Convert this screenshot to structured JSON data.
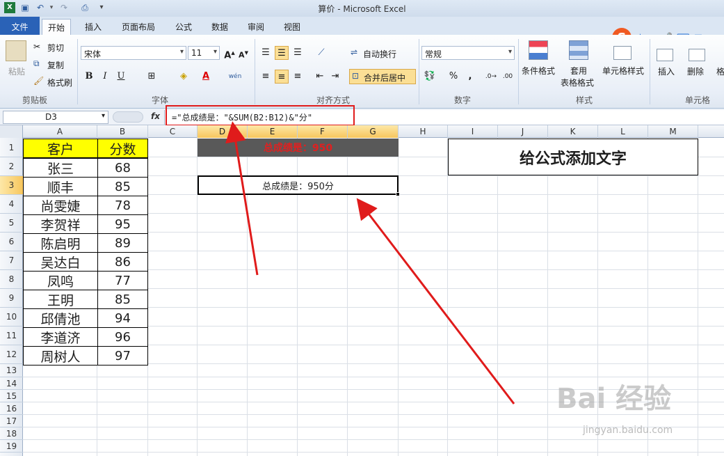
{
  "window": {
    "title": "算价 - Microsoft Excel"
  },
  "tabs": [
    "文件",
    "开始",
    "插入",
    "页面布局",
    "公式",
    "数据",
    "审阅",
    "视图"
  ],
  "ribbon": {
    "clipboard": {
      "paste": "粘贴",
      "cut": "剪切",
      "copy": "复制",
      "format_painter": "格式刷",
      "label": "剪贴板"
    },
    "font": {
      "name": "宋体",
      "size": "11",
      "bold": "B",
      "italic": "I",
      "underline": "U",
      "wen": "wén",
      "label": "字体"
    },
    "alignment": {
      "wrap": "自动换行",
      "merge": "合并后居中",
      "label": "对齐方式"
    },
    "number": {
      "format": "常规",
      "percent": "%",
      "comma": ",",
      "label": "数字"
    },
    "styles": {
      "conditional": "条件格式",
      "table_fmt_1": "套用",
      "table_fmt_2": "表格格式",
      "cell_styles": "单元格样式",
      "label": "样式"
    },
    "cells": {
      "insert": "插入",
      "delete": "删除",
      "format": "格",
      "label": "单元格"
    },
    "ime": {
      "lang": "中",
      "dot": "•,"
    }
  },
  "formula_bar": {
    "name_box": "D3",
    "fx": "fx",
    "formula": "=\"总成绩是：\"&SUM(B2:B12)&\"分\""
  },
  "columns": [
    "A",
    "B",
    "C",
    "D",
    "E",
    "F",
    "G",
    "H",
    "I",
    "J",
    "K",
    "L",
    "M"
  ],
  "rows": [
    "1",
    "2",
    "3",
    "4",
    "5",
    "6",
    "7",
    "8",
    "9",
    "10",
    "11",
    "12",
    "13",
    "14",
    "15",
    "16",
    "17",
    "18",
    "19"
  ],
  "table": {
    "headers": [
      "客户",
      "分数"
    ],
    "rows": [
      [
        "张三",
        "68"
      ],
      [
        "顺丰",
        "85"
      ],
      [
        "尚雯婕",
        "78"
      ],
      [
        "李贺祥",
        "95"
      ],
      [
        "陈启明",
        "89"
      ],
      [
        "吴达白",
        "86"
      ],
      [
        "凤鸣",
        "77"
      ],
      [
        "王明",
        "85"
      ],
      [
        "邱倩池",
        "94"
      ],
      [
        "李道济",
        "96"
      ],
      [
        "周树人",
        "97"
      ]
    ]
  },
  "cells": {
    "d1": "总成绩是：950",
    "d3": "总成绩是：950分",
    "title": "给公式添加文字"
  },
  "watermark": {
    "main": "Bai 经验",
    "sub": "jingyan.baidu.com"
  },
  "colors": {
    "file_tab": "#2a62b7",
    "header_fill": "#ffff00",
    "d1_fill": "#595959",
    "d1_text": "#e02020",
    "arrow": "#e01b1b",
    "selected_header": "#f7c65d"
  }
}
